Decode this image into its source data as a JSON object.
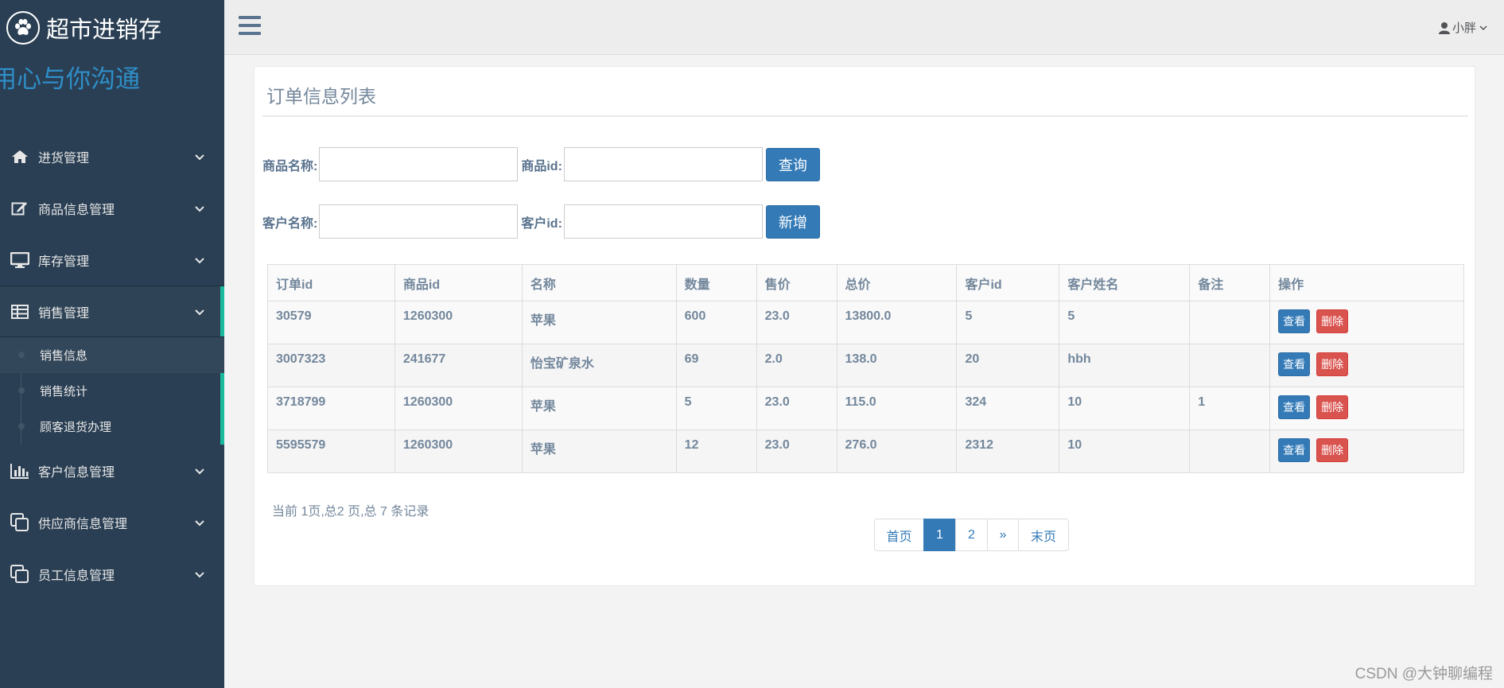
{
  "brand": {
    "title": "超市进销存",
    "slogan": "用心与你沟通"
  },
  "sidebar": {
    "items": [
      {
        "label": "进货管理",
        "icon": "home-icon"
      },
      {
        "label": "商品信息管理",
        "icon": "edit-icon"
      },
      {
        "label": "库存管理",
        "icon": "desktop-icon"
      },
      {
        "label": "销售管理",
        "icon": "table-icon"
      },
      {
        "label": "客户信息管理",
        "icon": "bar-chart-icon"
      },
      {
        "label": "供应商信息管理",
        "icon": "clone-icon"
      },
      {
        "label": "员工信息管理",
        "icon": "clone-icon"
      }
    ],
    "submenu": [
      {
        "label": "销售信息"
      },
      {
        "label": "销售统计"
      },
      {
        "label": "顾客退货办理"
      }
    ]
  },
  "topbar": {
    "user": "小胖"
  },
  "panel": {
    "title": "订单信息列表",
    "search": {
      "product_name_label": "商品名称:",
      "product_id_label": "商品id:",
      "query_button": "查询",
      "customer_name_label": "客户名称:",
      "customer_id_label": "客户id:",
      "add_button": "新增"
    },
    "table": {
      "headers": [
        "订单id",
        "商品id",
        "名称",
        "数量",
        "售价",
        "总价",
        "客户id",
        "客户姓名",
        "备注",
        "操作"
      ],
      "rows": [
        [
          "30579",
          "1260300",
          "苹果",
          "600",
          "23.0",
          "13800.0",
          "5",
          "5",
          ""
        ],
        [
          "3007323",
          "241677",
          "怡宝矿泉水",
          "69",
          "2.0",
          "138.0",
          "20",
          "hbh",
          ""
        ],
        [
          "3718799",
          "1260300",
          "苹果",
          "5",
          "23.0",
          "115.0",
          "324",
          "10",
          "1"
        ],
        [
          "5595579",
          "1260300",
          "苹果",
          "12",
          "23.0",
          "276.0",
          "2312",
          "10",
          ""
        ]
      ],
      "view_label": "查看",
      "delete_label": "删除"
    },
    "page_info": "当前 1页,总2 页,总 7 条记录",
    "pagination": {
      "first": "首页",
      "pages": [
        "1",
        "2"
      ],
      "current": "1",
      "next": "»",
      "last": "末页"
    }
  },
  "watermark": "CSDN @大钟聊编程",
  "colors": {
    "sidebar": "#2a3f54",
    "accent": "#1abb9c",
    "primary": "#337ab7",
    "danger": "#d9534f"
  }
}
